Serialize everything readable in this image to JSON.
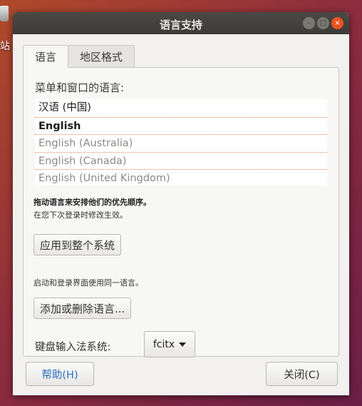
{
  "desktop": {
    "icon_label": "站"
  },
  "window": {
    "title": "语言支持",
    "controls": {
      "minimize_glyph": "–",
      "maximize_glyph": "□",
      "close_glyph": "×"
    }
  },
  "tabs": [
    {
      "label": "语言",
      "active": true
    },
    {
      "label": "地区格式",
      "active": false
    }
  ],
  "language_section": {
    "title": "菜单和窗口的语言:",
    "languages": [
      "汉语 (中国)",
      "English",
      "English (Australia)",
      "English (Canada)",
      "English (United Kingdom)"
    ],
    "hint_strong": "拖动语言来安排他们的优先顺序。",
    "hint": "在您下次登录时修改生效。",
    "apply_button": "应用到整个系统",
    "hint2": "启动和登录界面使用同一语言。",
    "add_remove_button": "添加或删除语言...",
    "keyboard_label": "键盘输入法系统:",
    "keyboard_value": "fcitx"
  },
  "footer": {
    "help_button": "帮助(H)",
    "close_button": "关闭(C)"
  },
  "colors": {
    "accent": "#e95420",
    "help_text": "#2a6ebd"
  }
}
